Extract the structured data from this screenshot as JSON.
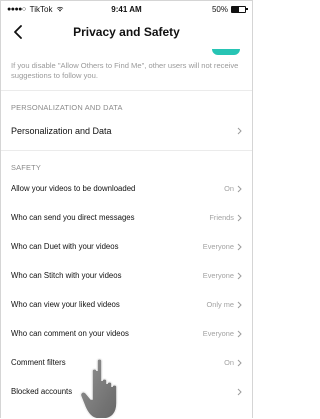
{
  "status_bar": {
    "carrier": "TikTok",
    "time": "9:41 AM",
    "battery": "50%",
    "battery_level": 0.5
  },
  "header": {
    "title": "Privacy and Safety",
    "back_icon": "chevron-left-icon"
  },
  "find_me_toggle": {
    "on": true,
    "color": "#27c4b4"
  },
  "notice": "If you disable \"Allow Others to Find Me\", other users will not receive suggestions to follow you.",
  "personalization": {
    "section_title": "PERSONALIZATION AND DATA",
    "item_label": "Personalization and Data"
  },
  "safety": {
    "section_title": "SAFETY",
    "items": [
      {
        "label": "Allow your videos to be downloaded",
        "value": "On"
      },
      {
        "label": "Who can send you direct messages",
        "value": "Friends"
      },
      {
        "label": "Who can Duet with your videos",
        "value": "Everyone"
      },
      {
        "label": "Who can Stitch with your videos",
        "value": "Everyone"
      },
      {
        "label": "Who can view your liked videos",
        "value": "Only me"
      },
      {
        "label": "Who can comment on your videos",
        "value": "Everyone"
      },
      {
        "label": "Comment filters",
        "value": "On"
      },
      {
        "label": "Blocked accounts",
        "value": ""
      }
    ]
  },
  "colors": {
    "accent": "#27c4b4",
    "muted_text": "#9a9a9a"
  }
}
